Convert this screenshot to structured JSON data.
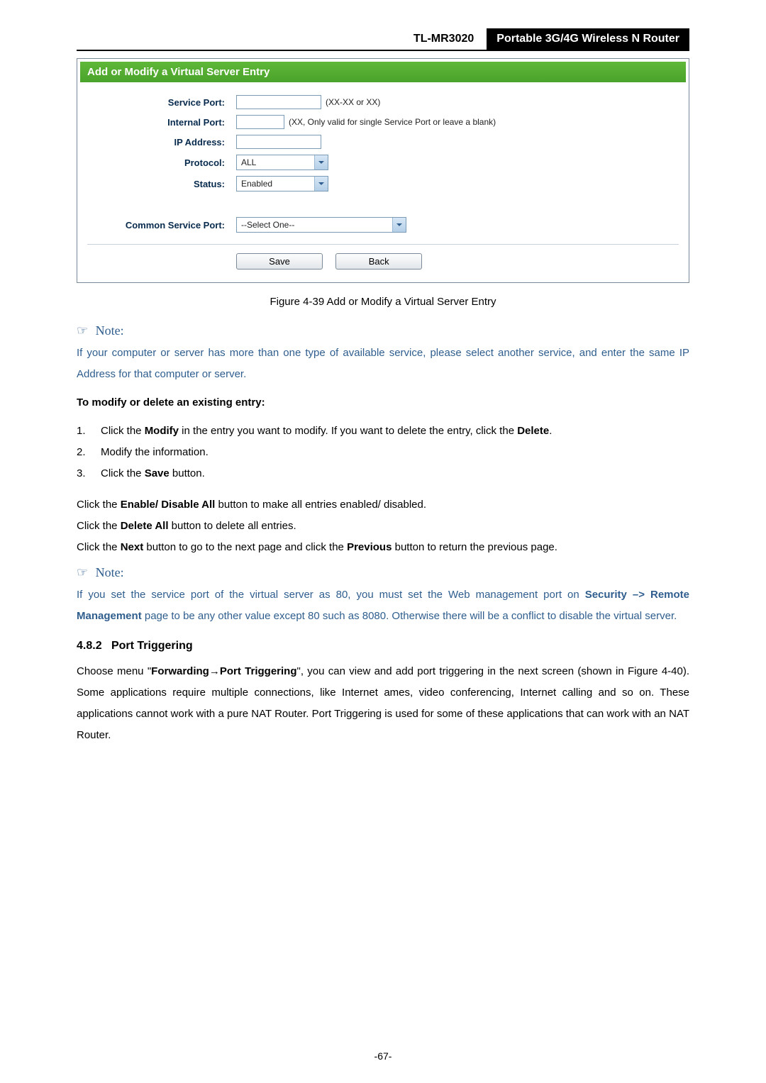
{
  "header": {
    "model": "TL-MR3020",
    "title": "Portable 3G/4G Wireless N Router"
  },
  "screenshot": {
    "panel_title": "Add or Modify a Virtual Server Entry",
    "fields": {
      "service_port": {
        "label": "Service Port:",
        "value": "",
        "hint": "(XX-XX or XX)"
      },
      "internal_port": {
        "label": "Internal Port:",
        "value": "",
        "hint": "(XX, Only valid for single Service Port or leave a blank)"
      },
      "ip_address": {
        "label": "IP Address:",
        "value": ""
      },
      "protocol": {
        "label": "Protocol:",
        "value": "ALL"
      },
      "status": {
        "label": "Status:",
        "value": "Enabled"
      },
      "common_service_port": {
        "label": "Common Service Port:",
        "value": "--Select One--"
      }
    },
    "buttons": {
      "save": "Save",
      "back": "Back"
    },
    "caption": "Figure 4-39   Add or Modify a Virtual Server Entry"
  },
  "note1": {
    "heading": "Note:",
    "text": "If your computer or server has more than one type of available service, please select another service, and enter the same IP Address for that computer or server."
  },
  "modify": {
    "heading": "To modify or delete an existing entry:",
    "steps": [
      {
        "num": "1.",
        "pre": "Click the ",
        "b1": "Modify",
        "mid": " in the entry you want to modify. If you want to delete the entry, click the ",
        "b2": "Delete",
        "post": "."
      },
      {
        "num": "2.",
        "text": "Modify the information."
      },
      {
        "num": "3.",
        "pre": "Click the ",
        "b1": "Save",
        "post": " button."
      }
    ]
  },
  "paras": {
    "p1": {
      "pre": "Click the ",
      "b": "Enable/ Disable All",
      "post": " button to make all entries enabled/ disabled."
    },
    "p2": {
      "pre": "Click the ",
      "b": "Delete All",
      "post": " button to delete all entries."
    },
    "p3": {
      "pre": "Click the ",
      "b1": "Next",
      "mid": " button to go to the next page and click the ",
      "b2": "Previous",
      "post": " button to return the previous page."
    }
  },
  "note2": {
    "heading": "Note:",
    "pre": "If you set the service port of the virtual server as 80, you must set the Web management port on ",
    "b": "Security –> Remote Management",
    "post": " page to be any other value except 80 such as 8080. Otherwise there will be a conflict to disable the virtual server."
  },
  "section": {
    "num": "4.8.2",
    "title": "Port Triggering"
  },
  "section_body": {
    "pre": "Choose menu \"",
    "b1": "Forwarding",
    "arrow": "→",
    "b2": "Port Triggering",
    "post": "\", you can view and add port triggering in the next screen (shown in Figure 4-40). Some applications require multiple connections, like Internet ames, video conferencing, Internet calling and so on. These applications cannot work with a pure NAT Router. Port Triggering is used for some of these applications that can work with an NAT Router."
  },
  "page_num": "-67-"
}
